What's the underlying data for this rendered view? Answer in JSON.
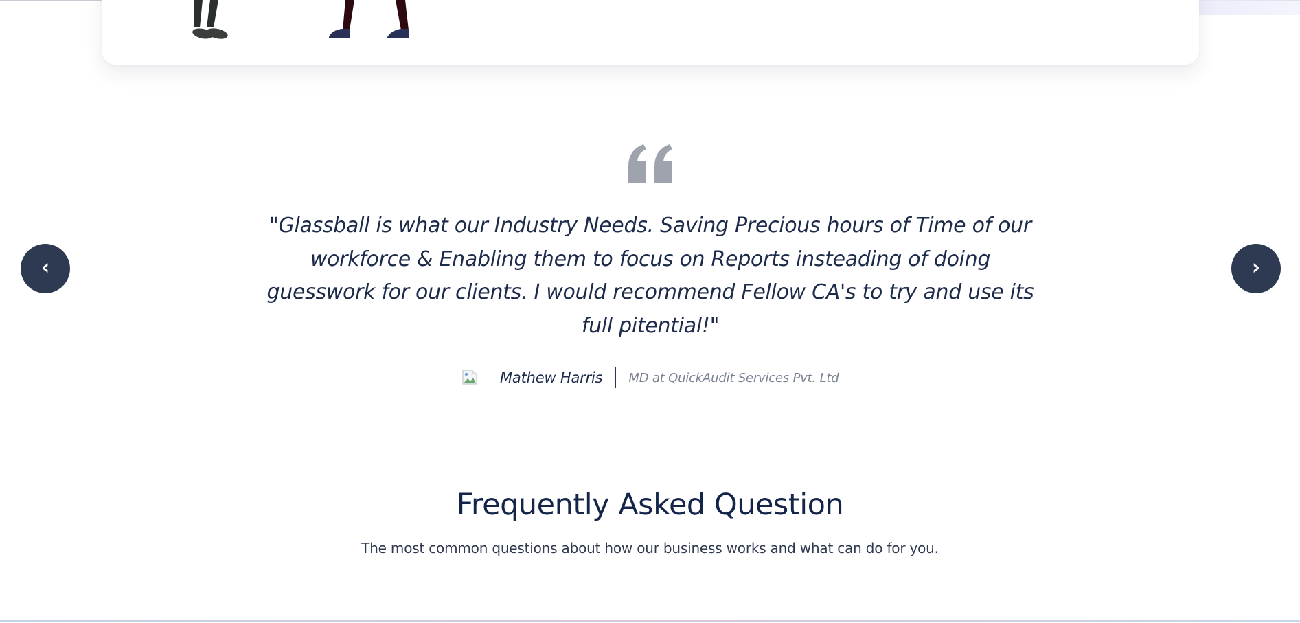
{
  "testimonial": {
    "quote": "\"Glassball is what our Industry Needs. Saving Precious hours of Time of our workforce & Enabling them to focus on Reports insteading of doing guesswork for our clients. I would recommend Fellow CA's to try and use its full pitential!\"",
    "author_name": "Mathew Harris",
    "author_role": "MD at QuickAudit Services Pvt. Ltd",
    "prev_label": "‹",
    "next_label": "›"
  },
  "faq": {
    "title": "Frequently Asked Question",
    "subtitle": "The most common questions about how our business works and what can do for you."
  },
  "colors": {
    "heading": "#14254a",
    "nav_button": "#2e3a52",
    "quote_icon": "#9ea3ae"
  },
  "icons": {
    "quote": "quote-icon",
    "prev": "chevron-left-icon",
    "next": "chevron-right-icon",
    "avatar": "broken-image-icon"
  }
}
